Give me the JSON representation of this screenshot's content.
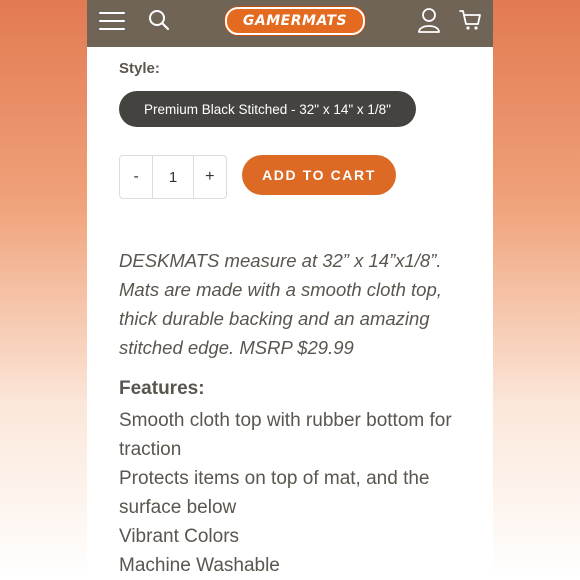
{
  "header": {
    "logo_text": "GAMERMATS",
    "icons": [
      "hamburger-menu-icon",
      "search-icon",
      "user-icon",
      "cart-icon"
    ],
    "bg_color": "#6f6456",
    "accent_color": "#e36a1e"
  },
  "product": {
    "style_label": "Style:",
    "style_value": "Premium Black Stitched - 32\" x 14\" x 1/8\"",
    "quantity": {
      "minus": "-",
      "value": "1",
      "plus": "+"
    },
    "add_to_cart": "ADD TO CART",
    "description": "DESKMATS measure at 32” x 14”x1/8”. Mats are made with a smooth cloth top, thick durable backing and an amazing stitched edge. MSRP $29.99",
    "features_heading": "Features:",
    "features": [
      "Smooth cloth top with rubber bottom for traction",
      "Protects items on top of mat, and the surface below",
      "Vibrant Colors",
      "Machine Washable"
    ]
  }
}
